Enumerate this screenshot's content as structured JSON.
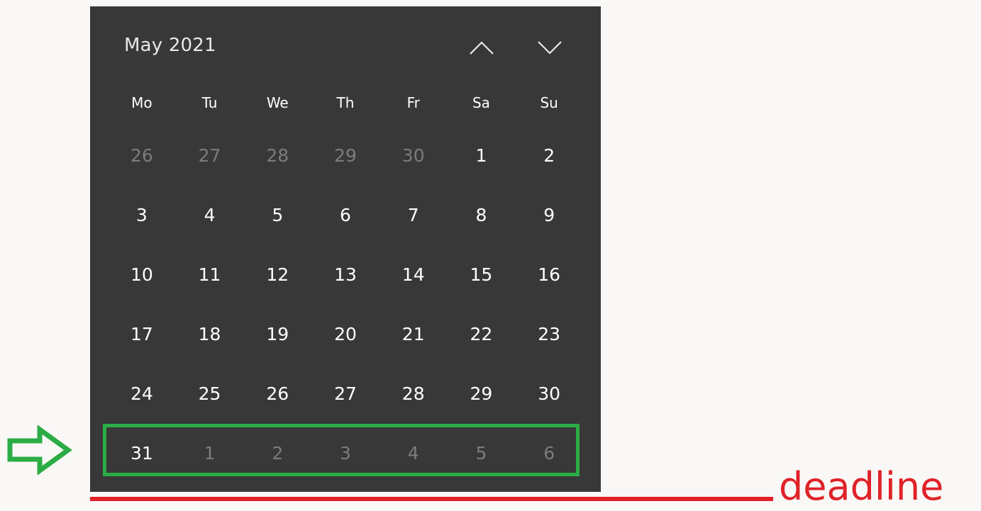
{
  "calendar": {
    "month_title": "May 2021",
    "nav": {
      "prev_icon": "chevron-up-icon",
      "next_icon": "chevron-down-icon"
    },
    "weekdays": [
      "Mo",
      "Tu",
      "We",
      "Th",
      "Fr",
      "Sa",
      "Su"
    ],
    "weeks": [
      [
        {
          "d": "26",
          "other": true
        },
        {
          "d": "27",
          "other": true
        },
        {
          "d": "28",
          "other": true
        },
        {
          "d": "29",
          "other": true
        },
        {
          "d": "30",
          "other": true
        },
        {
          "d": "1",
          "other": false
        },
        {
          "d": "2",
          "other": false
        }
      ],
      [
        {
          "d": "3",
          "other": false
        },
        {
          "d": "4",
          "other": false
        },
        {
          "d": "5",
          "other": false
        },
        {
          "d": "6",
          "other": false
        },
        {
          "d": "7",
          "other": false
        },
        {
          "d": "8",
          "other": false
        },
        {
          "d": "9",
          "other": false
        }
      ],
      [
        {
          "d": "10",
          "other": false
        },
        {
          "d": "11",
          "other": false
        },
        {
          "d": "12",
          "other": false
        },
        {
          "d": "13",
          "other": false
        },
        {
          "d": "14",
          "other": false
        },
        {
          "d": "15",
          "other": false
        },
        {
          "d": "16",
          "other": false
        }
      ],
      [
        {
          "d": "17",
          "other": false
        },
        {
          "d": "18",
          "other": false
        },
        {
          "d": "19",
          "other": false
        },
        {
          "d": "20",
          "other": false
        },
        {
          "d": "21",
          "other": false
        },
        {
          "d": "22",
          "other": false
        },
        {
          "d": "23",
          "other": false
        }
      ],
      [
        {
          "d": "24",
          "other": false
        },
        {
          "d": "25",
          "other": false
        },
        {
          "d": "26",
          "other": false
        },
        {
          "d": "27",
          "other": false
        },
        {
          "d": "28",
          "other": false
        },
        {
          "d": "29",
          "other": false
        },
        {
          "d": "30",
          "other": false
        }
      ],
      [
        {
          "d": "31",
          "other": false
        },
        {
          "d": "1",
          "other": true
        },
        {
          "d": "2",
          "other": true
        },
        {
          "d": "3",
          "other": true
        },
        {
          "d": "4",
          "other": true
        },
        {
          "d": "5",
          "other": true
        },
        {
          "d": "6",
          "other": true
        }
      ]
    ]
  },
  "annotations": {
    "deadline_label": "deadline",
    "arrow_icon": "right-arrow-outline-icon"
  },
  "colors": {
    "calendar_bg": "#383838",
    "page_bg": "#f9f8f6",
    "highlight": "#2cac45",
    "deadline": "#e02228"
  }
}
